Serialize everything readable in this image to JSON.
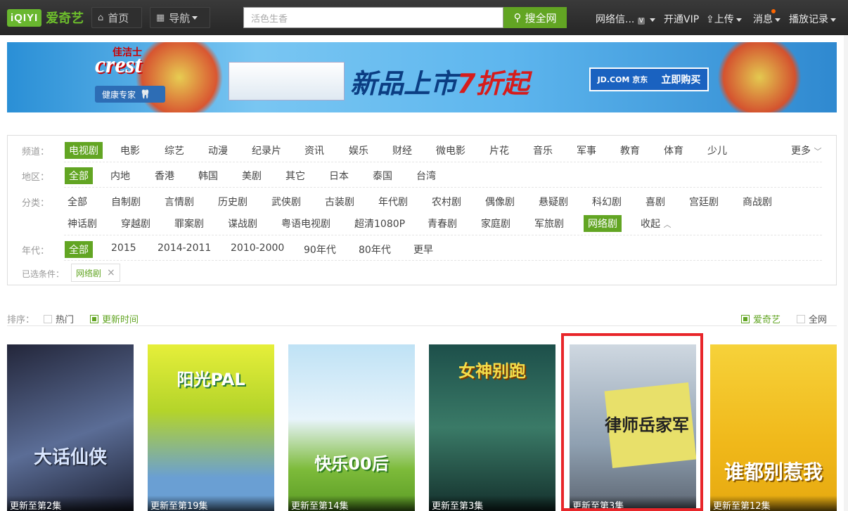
{
  "topbar": {
    "logo_mark": "iQIYI",
    "logo_text": "爱奇艺",
    "home": "首页",
    "nav": "导航",
    "search_placeholder": "活色生香",
    "search_button": "搜全网",
    "user": "网络信...",
    "vip": "开通VIP",
    "upload": "上传",
    "message": "消息",
    "history": "播放记录"
  },
  "banner": {
    "brand": "佳洁士",
    "logo": "crest",
    "badge": "健康专家",
    "slogan": "新品上市",
    "discount": "7折起",
    "jd_logo": "JD.COM 京东",
    "cta": "立即购买"
  },
  "filter": {
    "channel": {
      "label": "频道：",
      "items": [
        "电视剧",
        "电影",
        "综艺",
        "动漫",
        "纪录片",
        "资讯",
        "娱乐",
        "财经",
        "微电影",
        "片花",
        "音乐",
        "军事",
        "教育",
        "体育",
        "少儿"
      ],
      "more": "更多"
    },
    "region": {
      "label": "地区：",
      "items": [
        "全部",
        "内地",
        "香港",
        "韩国",
        "美剧",
        "其它",
        "日本",
        "泰国",
        "台湾"
      ]
    },
    "category": {
      "label": "分类：",
      "row1": [
        "全部",
        "自制剧",
        "言情剧",
        "历史剧",
        "武侠剧",
        "古装剧",
        "年代剧",
        "农村剧",
        "偶像剧",
        "悬疑剧",
        "科幻剧",
        "喜剧",
        "宫廷剧",
        "商战剧"
      ],
      "row2": [
        "神话剧",
        "穿越剧",
        "罪案剧",
        "谍战剧",
        "粤语电视剧",
        "超清1080P",
        "青春剧",
        "家庭剧",
        "军旅剧",
        "网络剧"
      ],
      "collapse": "收起"
    },
    "year": {
      "label": "年代：",
      "items": [
        "全部",
        "2015",
        "2014-2011",
        "2010-2000",
        "90年代",
        "80年代",
        "更早"
      ]
    },
    "selected": {
      "label": "已选条件：",
      "chip": "网络剧"
    }
  },
  "sort": {
    "label": "排序：",
    "hot": "热门",
    "latest": "更新时间",
    "source_iqiyi": "爱奇艺",
    "source_all": "全网"
  },
  "cards": [
    {
      "title": "大话仙侠",
      "status": "更新至第2集",
      "bg": "#4c5a7a"
    },
    {
      "title": "阳光PAL",
      "status": "更新至第19集",
      "bg": "#c9dc3c"
    },
    {
      "title": "快乐00后",
      "status": "更新至第14集",
      "bg": "#8fc9e8"
    },
    {
      "title": "女神别跑",
      "status": "更新至第3集",
      "bg": "#2f6b5a"
    },
    {
      "title": "律师岳家军",
      "status": "更新至第3集",
      "bg": "#aab7c4"
    },
    {
      "title": "谁都别惹我",
      "status": "更新至第12集",
      "bg": "#f2c21a"
    }
  ]
}
